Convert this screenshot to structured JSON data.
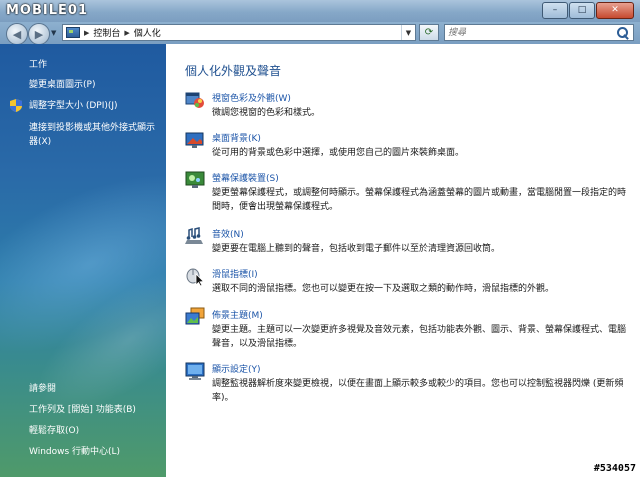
{
  "titlebar": {
    "logo": "MOBILE01",
    "minimize": "–",
    "maximize": "□",
    "close": "✕"
  },
  "address": {
    "crumbs": [
      "控制台",
      "個人化"
    ],
    "search_placeholder": "搜尋"
  },
  "sidebar": {
    "tasks": [
      "工作",
      "變更桌面圖示(P)",
      "調整字型大小 (DPI)(J)",
      "連接到投影機或其他外接式顯示器(X)"
    ],
    "see_also": [
      "請參閱",
      "工作列及 [開始] 功能表(B)",
      "輕鬆存取(O)",
      "Windows 行動中心(L)"
    ]
  },
  "main": {
    "title": "個人化外觀及聲音",
    "items": [
      {
        "title": "視窗色彩及外觀(W)",
        "desc": "微調您視窗的色彩和樣式。",
        "icon": "window-color-icon"
      },
      {
        "title": "桌面背景(K)",
        "desc": "從可用的背景或色彩中選擇，或使用您自己的圖片來裝飾桌面。",
        "icon": "desktop-background-icon"
      },
      {
        "title": "螢幕保護裝置(S)",
        "desc": "變更螢幕保護程式，或調整何時顯示。螢幕保護程式為涵蓋螢幕的圖片或動畫，當電腦閒置一段指定的時間時，便會出現螢幕保護程式。",
        "icon": "screensaver-icon"
      },
      {
        "title": "音效(N)",
        "desc": "變更要在電腦上聽到的聲音，包括收到電子郵件以至於清理資源回收筒。",
        "icon": "sound-icon"
      },
      {
        "title": "滑鼠指標(I)",
        "desc": "選取不同的滑鼠指標。您也可以變更在按一下及選取之類的動作時，滑鼠指標的外觀。",
        "icon": "mouse-pointer-icon"
      },
      {
        "title": "佈景主題(M)",
        "desc": "變更主題。主題可以一次變更許多視覺及音效元素，包括功能表外觀、圖示、背景、螢幕保護程式、電腦聲音，以及滑鼠指標。",
        "icon": "theme-icon"
      },
      {
        "title": "顯示設定(Y)",
        "desc": "調整監視器解析度來變更檢視，以便在畫面上顯示較多或較少的項目。您也可以控制監視器閃爍 (更新頻率)。",
        "icon": "display-settings-icon"
      }
    ]
  },
  "watermark": "#534057"
}
